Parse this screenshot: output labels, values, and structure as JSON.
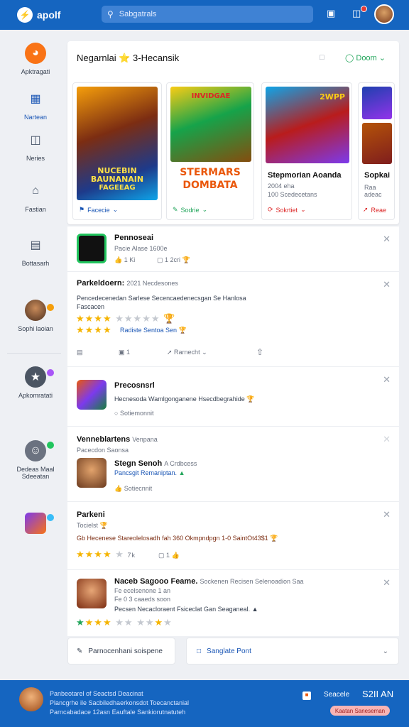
{
  "topbar": {
    "logo_text": "apolf",
    "search_placeholder": "Sabgatrals"
  },
  "sidebar": {
    "items": [
      {
        "label": "Apktragati"
      },
      {
        "label": "Nartean"
      },
      {
        "label": "Neries"
      },
      {
        "label": "Fastian"
      },
      {
        "label": "Bottasarh"
      },
      {
        "label": "Sophi laoian"
      },
      {
        "label": "Apkomratati"
      },
      {
        "label": "Dedeas Maal",
        "label2": "Sdeeatan"
      }
    ]
  },
  "featured": {
    "title": "Negarnlai ⭐ 3-Hecansik",
    "filter_label": "Doom",
    "cards": [
      {
        "art_title": "NUCEBIN",
        "art_title2": "BAUNANAIN",
        "art_title3": "FAGEEAG",
        "action": "Facecie"
      },
      {
        "art_title": "INVIDGAE",
        "art_title2": "STERMARS",
        "art_title3": "DOMBATA",
        "action": "Sodrie"
      },
      {
        "art_title": "2WPP",
        "title": "Stepmorian Aoanda",
        "sub1": "2004 eha",
        "sub2": "100 Scedecetans",
        "action": "Sokrtiet"
      },
      {
        "title": "Sopkai",
        "sub1": "Raa adeac",
        "action": "Reae"
      }
    ]
  },
  "feed": [
    {
      "title": "Pennoseai",
      "sub": "Pacie Alase 1600e",
      "meta1": "1 Ki",
      "meta2": "1 2cri"
    },
    {
      "title": "Parkeldoern:",
      "title_rest": "2021 Necdesones",
      "body1": "Pencedecenedan Sarlese Secencaedenecsgan Se Hanlosa",
      "body2": "Fascacen",
      "rating_link": "Radiste Sentoa Sen",
      "action_count": "1",
      "action_label": "Rarnecht"
    },
    {
      "title": "Precosnsrl",
      "body": "Hecnesoda Wamlgonganene Hsecdbegrahide",
      "action": "Sotiemonnit"
    },
    {
      "title": "Venneblartens",
      "title_rest": "Venpana",
      "sub": "Pacecdon Saonsa",
      "item_title": "Stegn Senoh",
      "item_title2": "A Crdbcess",
      "item_sub": "Pancsgit Remaniptan.",
      "action": "Sotiecnnit"
    },
    {
      "title": "Parkeni",
      "sub": "Tocielst",
      "body": "Gb Hecenese Stareolelosadh fah 360 Okmpndpgn 1-0 SaintOt43$1",
      "rating_label": "7k"
    },
    {
      "title": "Naceb Sagooo",
      "title2": "Feame.",
      "title_rest": "Sockenen Recisen Selenoadion Saa",
      "sub1": "Fe ecelsenone 1 an",
      "sub2": "Fe 0 3 caaeds soon",
      "sub3": "Pecsen Necacloraent Fsiceclat Gan Seaganeal."
    }
  ],
  "bottom": {
    "left_label": "Parnocenhani soispene",
    "right_label": "Sanglate Pont"
  },
  "footer": {
    "line1": "Panbeotarel of Seactsd Deacinat",
    "line2": "Plancgrhe ile Sacbiledhaerkonsdot Toecanctanial",
    "line3": "Parncabadace 12asn Eauftale Sankiorutnatuteh",
    "right_label": "Seacele",
    "right_value": "S2II AN",
    "pill": "Kaatan Saneseman"
  },
  "colors": {
    "brand": "#1565c0",
    "star": "#f5b400",
    "link": "#1a56b5"
  }
}
